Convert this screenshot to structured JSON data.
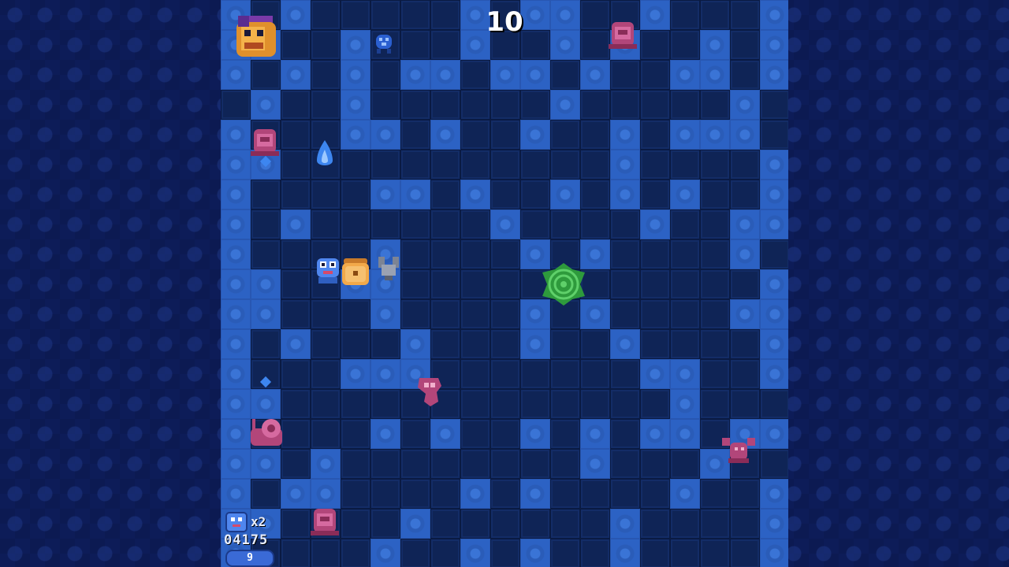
{
  "hud": {
    "timer": "10",
    "lives": "x2",
    "score": "04175",
    "level": "9"
  },
  "colors": {
    "floor": "#2c62c4",
    "wall": "#0f2456",
    "enemy": "#b2467a",
    "treasure": "#f2a94a",
    "vortex": "#2e9a3c"
  },
  "sprites": {
    "boss": "boss-face-icon",
    "hero": "hero-robot-icon",
    "chest": "treasure-chest-icon",
    "cup": "gray-cup-icon",
    "vortex": "green-vortex-icon",
    "ghost": "pink-ghost-icon",
    "crawler": "pink-crawler-icon",
    "snail": "pink-snail-icon",
    "bot": "blue-bot-icon",
    "flame": "blue-flame-icon"
  }
}
